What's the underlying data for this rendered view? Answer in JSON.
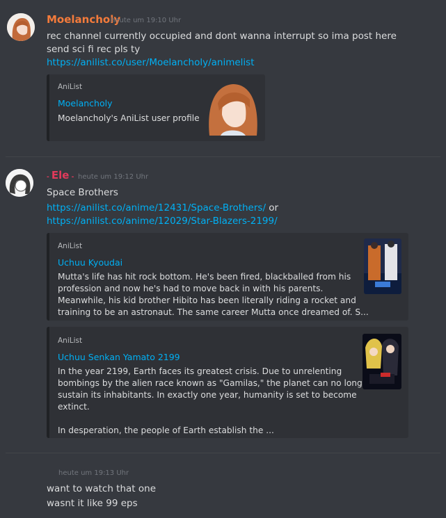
{
  "colors": {
    "background": "#36393f",
    "embed_bg": "#2f3136",
    "link": "#00b0f4",
    "username_1": "#f47b3b",
    "username_2": "#e03a5b",
    "timestamp": "#72767d"
  },
  "messages": [
    {
      "username": "Moelancholy",
      "timestamp": "heute um 19:10 Uhr",
      "lines": [
        "rec channel currently occupied and dont wanna interrupt so ima post here",
        "send sci fi rec pls ty"
      ],
      "link": "https://anilist.co/user/Moelancholy/animelist",
      "embed": {
        "provider": "AniList",
        "title": "Moelancholy",
        "description": "Moelancholy's AniList user profile"
      }
    },
    {
      "username": "Ele",
      "timestamp": "heute um 19:12 Uhr",
      "line": "Space Brothers",
      "link_1": "https://anilist.co/anime/12431/Space-Brothers/",
      "or": "or",
      "link_2": "https://anilist.co/anime/12029/Star-Blazers-2199/",
      "embeds": [
        {
          "provider": "AniList",
          "title": "Uchuu Kyoudai",
          "description": [
            "Mutta's life has hit rock bottom. He's been fired, blackballed from his",
            "profession and now he's had to move back in with his parents.",
            "Meanwhile, his kid brother Hibito has been literally riding a rocket and",
            "training to be an astronaut. The same career Mutta once dreamed of. S..."
          ]
        },
        {
          "provider": "AniList",
          "title": "Uchuu Senkan Yamato 2199",
          "description": [
            "In the year 2199, Earth faces its greatest crisis. Due to unrelenting",
            "bombings by the alien race known as \"Gamilas,\" the planet can no longer",
            "sustain its inhabitants. In exactly one year, humanity is set to become",
            "extinct.",
            "",
            "In desperation, the people of Earth establish the ..."
          ]
        }
      ]
    },
    {
      "timestamp": "heute um 19:13 Uhr",
      "lines": [
        "want to watch that one",
        "wasnt it like 99 eps"
      ]
    }
  ]
}
